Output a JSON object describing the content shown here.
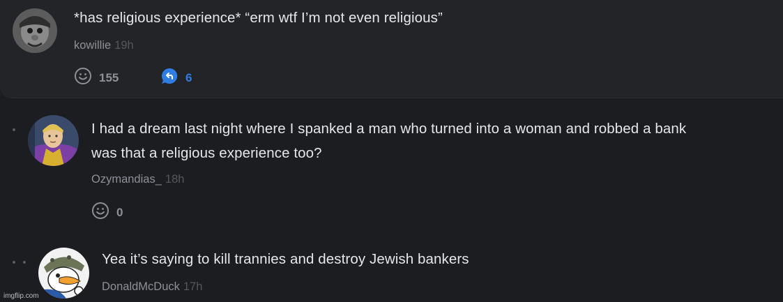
{
  "comments": [
    {
      "text": "*has religious experience* “erm wtf I’m not even religious”",
      "username": "kowillie",
      "time": "19h",
      "likes": "155",
      "replies": "6"
    },
    {
      "text_line1": "I had a dream last night where I spanked a man who turned into a woman and robbed a bank",
      "text_line2": "was that a religious experience too?",
      "username": "Ozymandias_",
      "time": "18h",
      "likes": "0"
    },
    {
      "text": "Yea it’s saying to kill trannies and destroy Jewish bankers",
      "username": "DonaldMcDuck",
      "time": "17h"
    }
  ],
  "watermark": "imgflip.com",
  "colors": {
    "background": "#1c1d21",
    "highlight_block": "#232428",
    "reply_accent": "#2f7de1"
  },
  "icons": [
    "smiley-icon",
    "reply-arrow-icon"
  ]
}
